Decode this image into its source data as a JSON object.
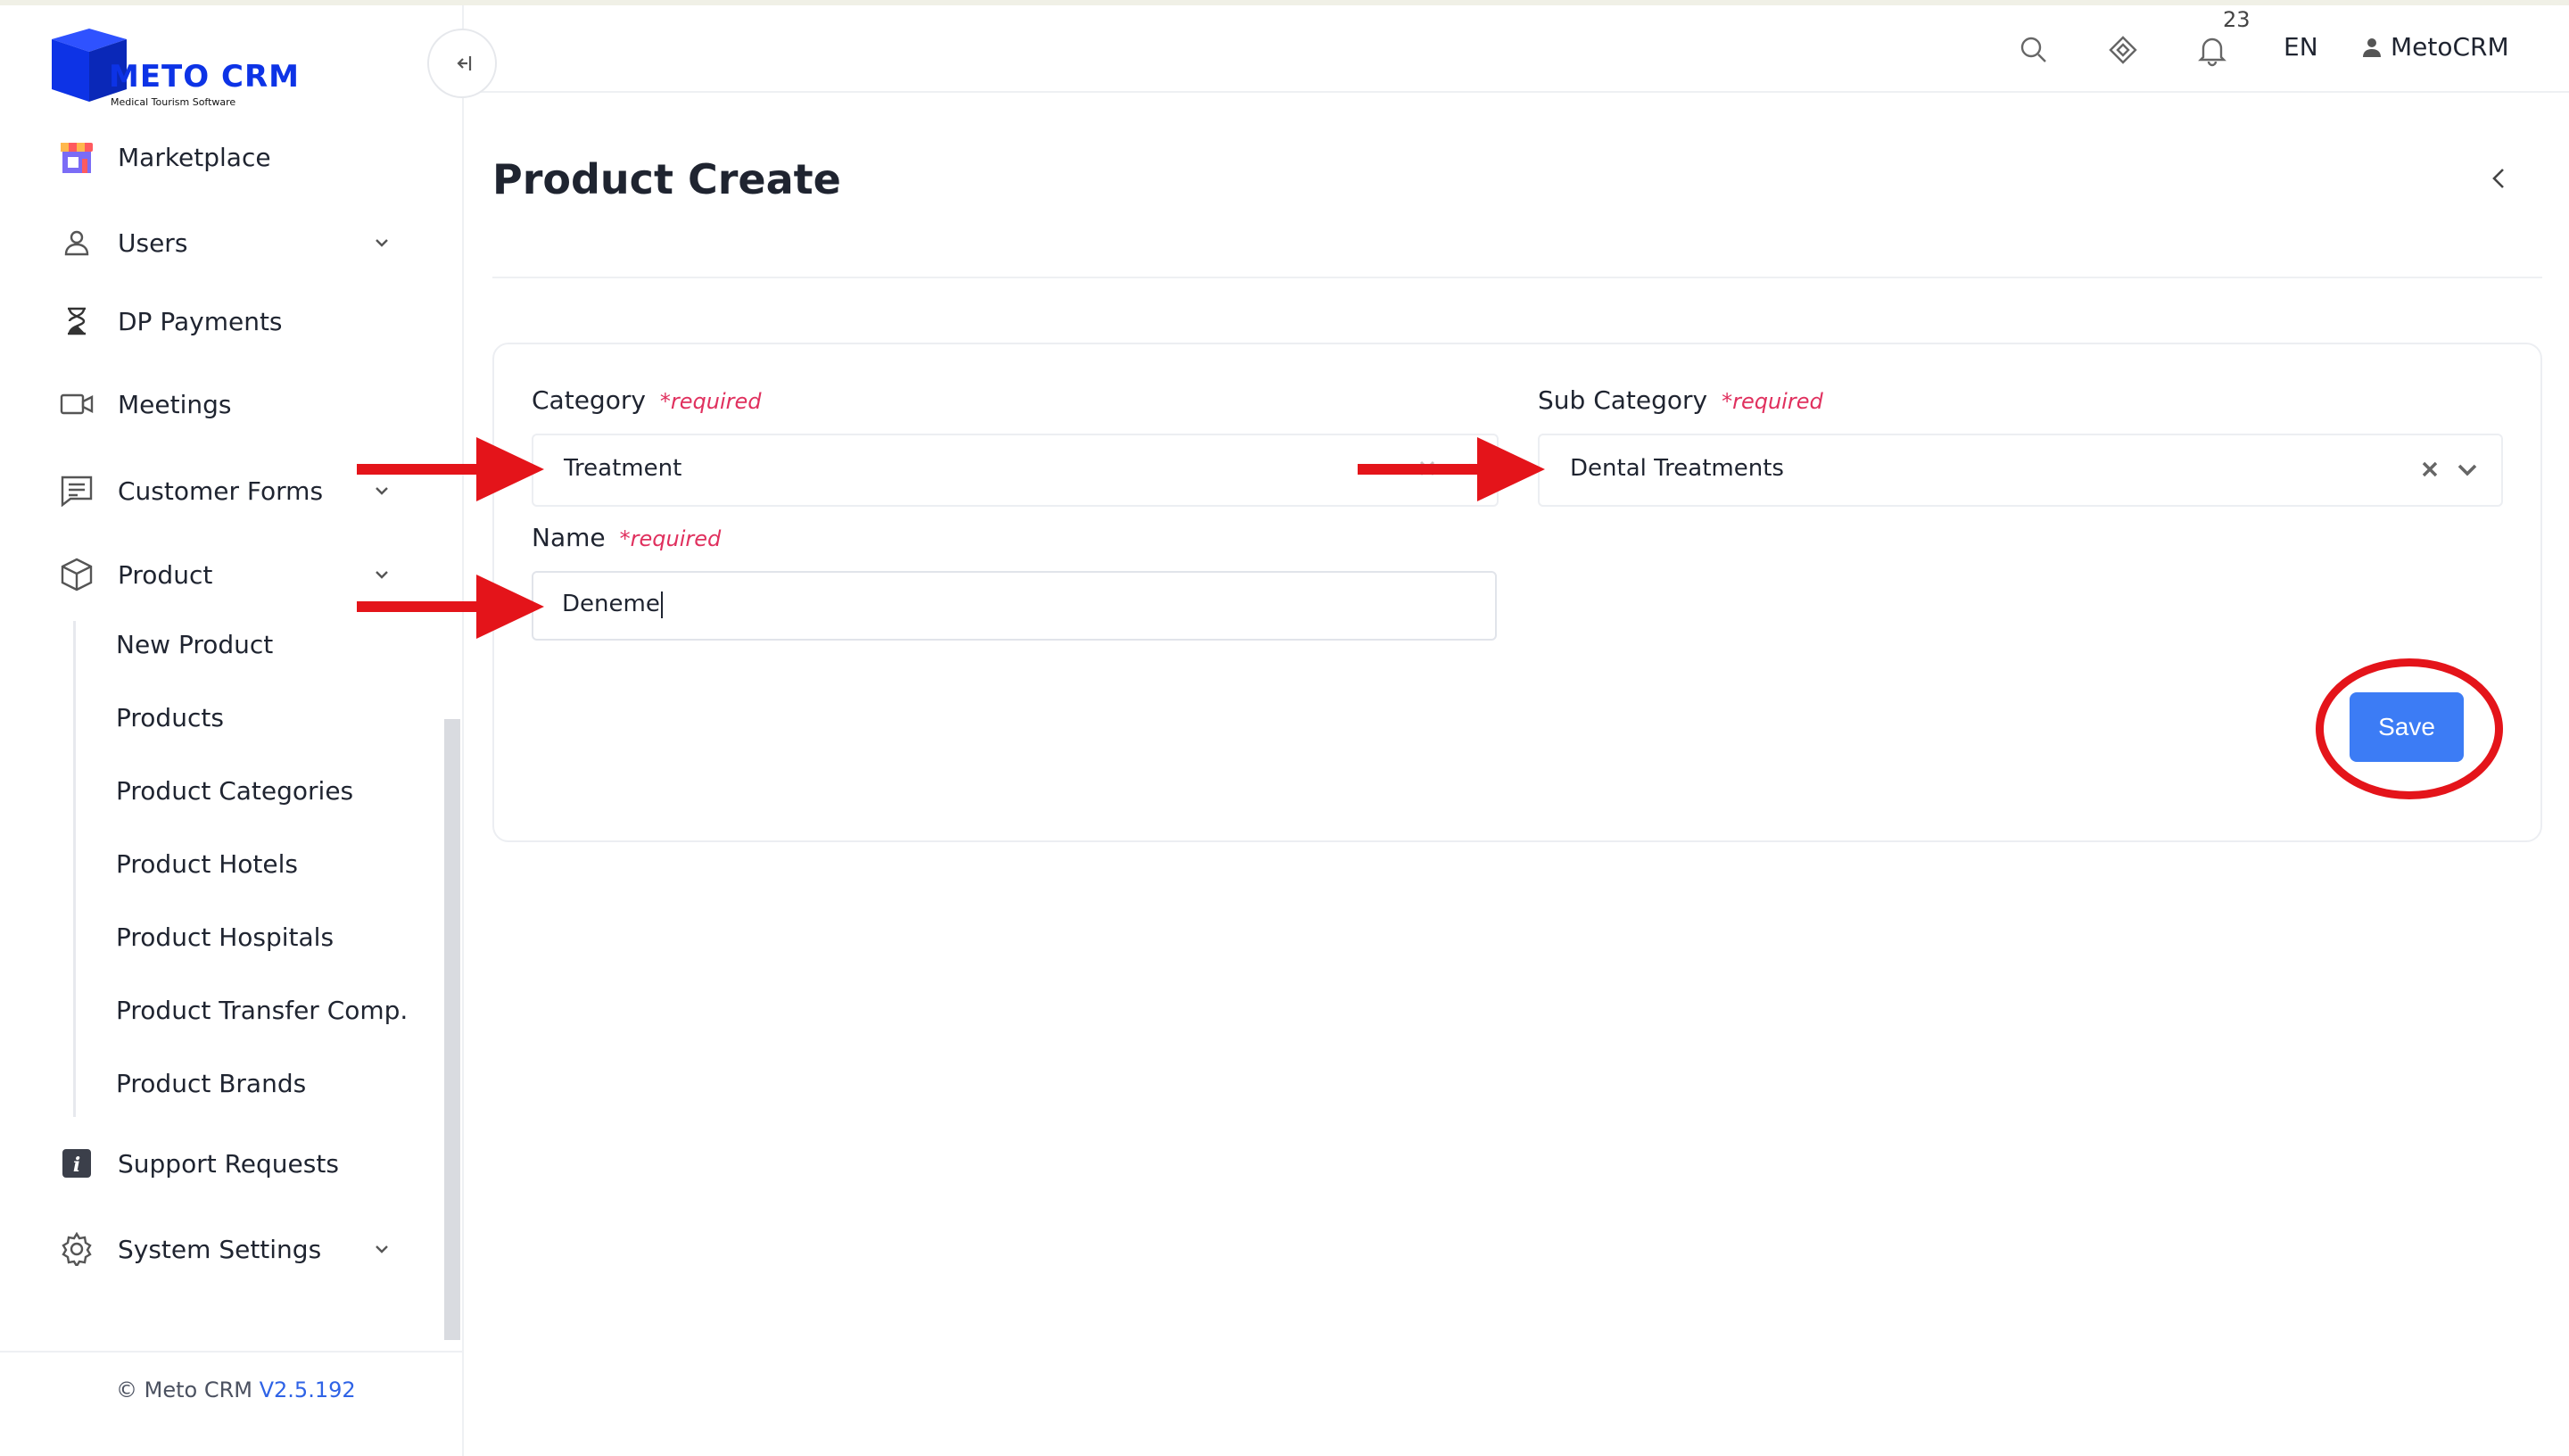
{
  "brand": {
    "name": "METO CRM",
    "tagline": "Medical Tourism Software",
    "primary_color": "#0d33e6"
  },
  "header": {
    "icons": [
      "search-icon",
      "diamond-icon",
      "bell-icon"
    ],
    "notifications_count": "23",
    "language": "EN",
    "user_name": "MetoCRM"
  },
  "sidebar": {
    "items": [
      {
        "label": "Marketplace",
        "icon": "store-icon"
      },
      {
        "label": "Users",
        "icon": "user-icon",
        "has_children": true
      },
      {
        "label": "DP Payments",
        "icon": "hourglass-icon"
      },
      {
        "label": "Meetings",
        "icon": "video-icon"
      },
      {
        "label": "Customer Forms",
        "icon": "form-icon",
        "has_children": true
      },
      {
        "label": "Product",
        "icon": "box-icon",
        "has_children": true,
        "expanded": true
      },
      {
        "label": "Support Requests",
        "icon": "info-icon"
      },
      {
        "label": "System Settings",
        "icon": "gear-icon",
        "has_children": true
      }
    ],
    "product_children": [
      "New Product",
      "Products",
      "Product Categories",
      "Product Hotels",
      "Product Hospitals",
      "Product Transfer Comp.",
      "Product Brands"
    ],
    "footer": {
      "copyright": "© Meto CRM",
      "version": "V2.5.192"
    }
  },
  "page": {
    "title": "Product Create"
  },
  "form": {
    "required_text": "*required",
    "category": {
      "label": "Category",
      "value": "Treatment"
    },
    "sub_category": {
      "label": "Sub Category",
      "value": "Dental Treatments"
    },
    "name": {
      "label": "Name",
      "value": "Deneme"
    },
    "save_label": "Save"
  },
  "colors": {
    "accent": "#3c7cf5",
    "required": "#e0305e",
    "annotation": "#e4141a"
  }
}
